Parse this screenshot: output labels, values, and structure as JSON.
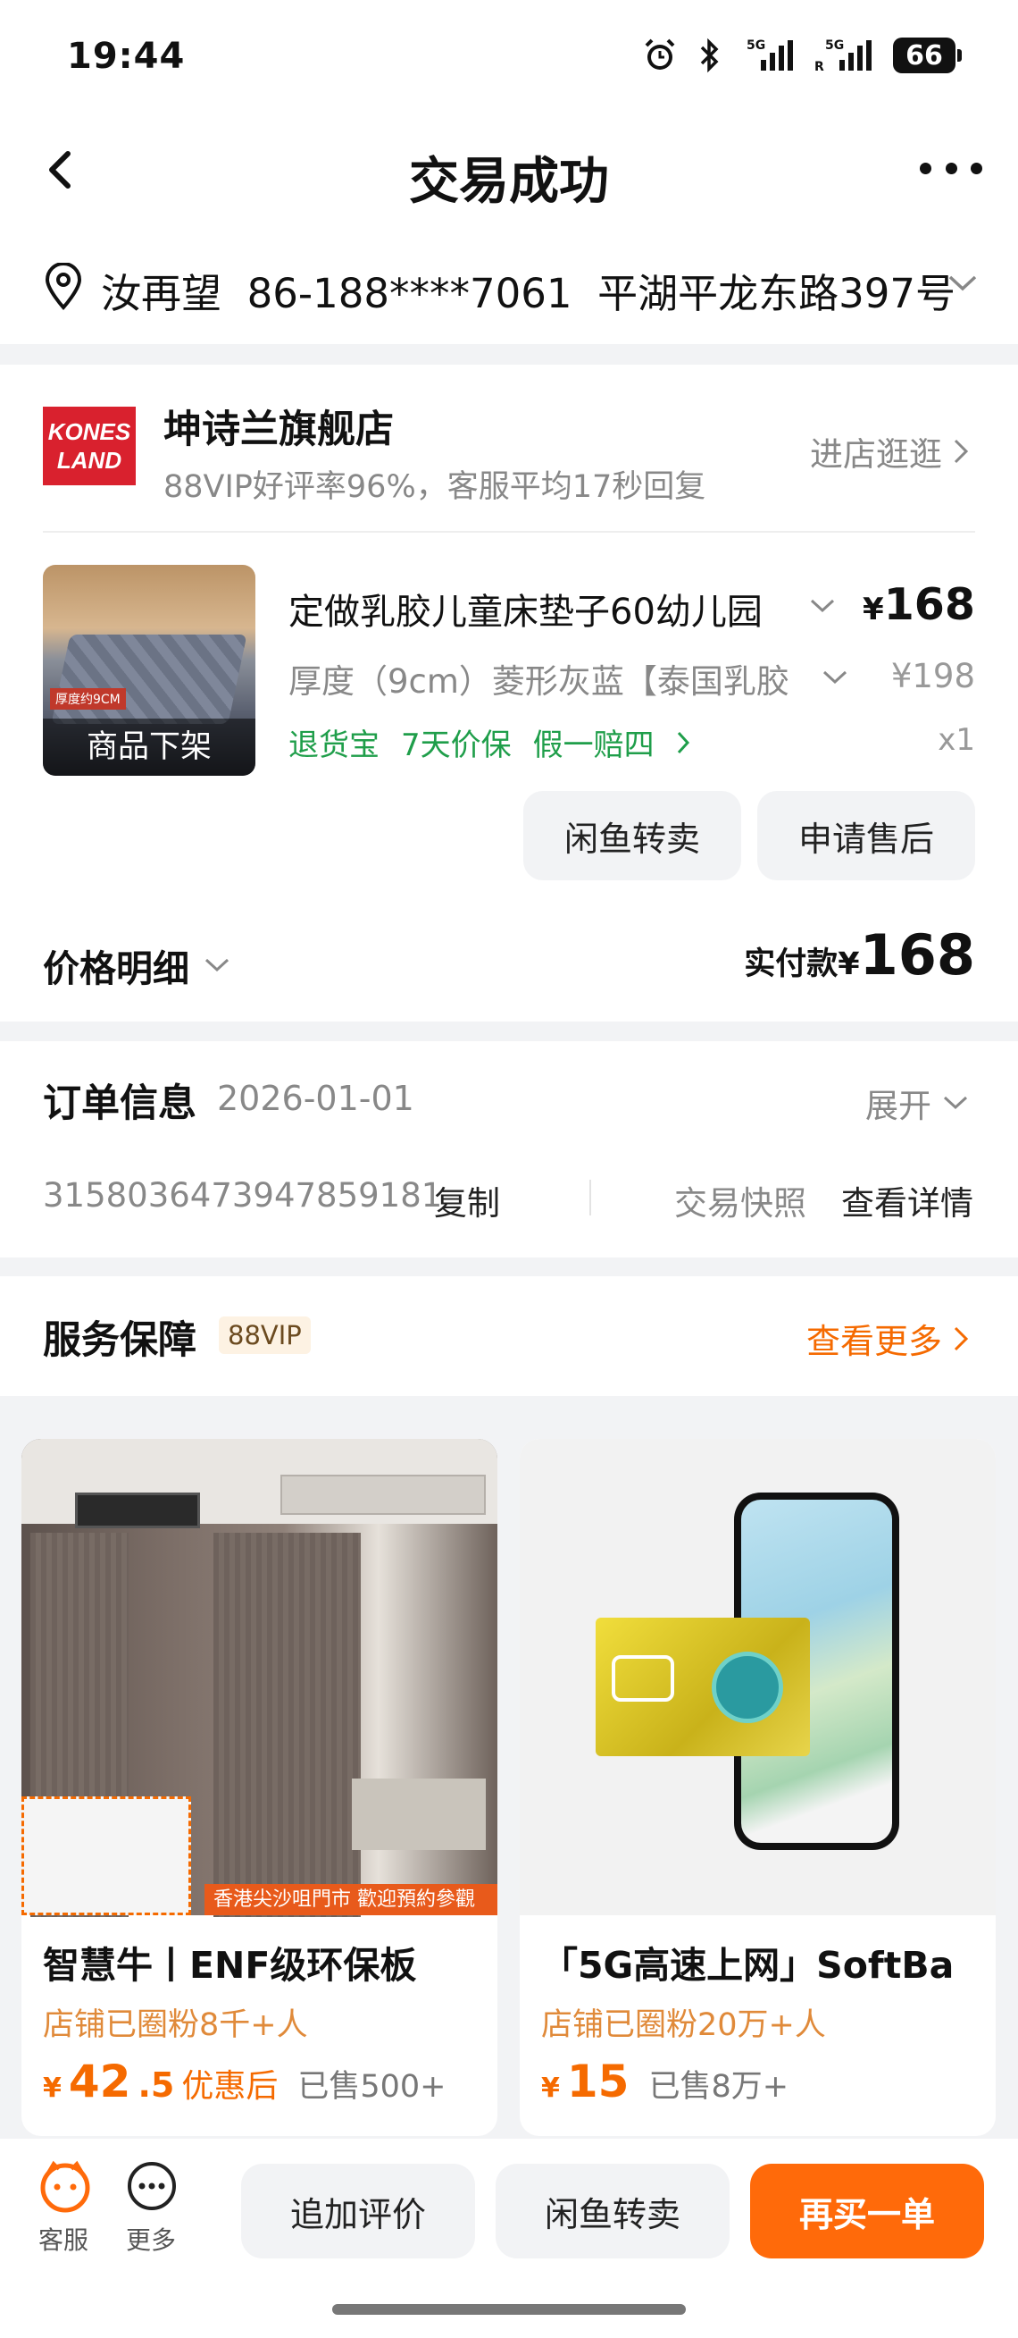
{
  "status": {
    "time": "19:44",
    "battery": "66"
  },
  "nav": {
    "title": "交易成功"
  },
  "address": {
    "name": "汝再望",
    "phone": "86-188****7061",
    "detail": "平湖平龙东路397号"
  },
  "store": {
    "logo_line1": "KONES",
    "logo_line2": "LAND",
    "name": "坤诗兰旗舰店",
    "sub": "88VIP好评率96%，客服平均17秒回复",
    "enter": "进店逛逛"
  },
  "product": {
    "img_overlay": "商品下架",
    "img_tag": "厚度约9CM",
    "title": "定做乳胶儿童床垫子60幼儿园",
    "spec": "厚度（9cm）菱形灰蓝【泰国乳胶",
    "price": "168",
    "currency": "¥",
    "orig_price": "¥198",
    "qty": "x1",
    "services": [
      "退货宝",
      "7天价保",
      "假一赔四"
    ]
  },
  "actions": {
    "resell": "闲鱼转卖",
    "after_sale": "申请售后"
  },
  "price_detail": {
    "label": "价格明细",
    "paid_label": "实付款",
    "currency": "¥",
    "amount": "168"
  },
  "order_info": {
    "title": "订单信息",
    "date": "2026-01-01",
    "expand": "展开",
    "order_no": "3158036473947859181",
    "copy": "复制",
    "snapshot": "交易快照",
    "details": "查看详情"
  },
  "service": {
    "title": "服务保障",
    "badge": "88VIP",
    "more": "查看更多"
  },
  "recommendations": [
    {
      "title": "智慧牛丨ENF级环保板",
      "fans": "店铺已圈粉8千+人",
      "currency": "¥",
      "price_int": "42",
      "price_dec": ".5",
      "price_tag": "优惠后",
      "sold": "已售500+",
      "banner": "香港尖沙咀門市 歡迎預約參觀"
    },
    {
      "title": "「5G高速上网」SoftBa",
      "fans": "店铺已圈粉20万+人",
      "currency": "¥",
      "price_int": "15",
      "price_dec": "",
      "price_tag": "",
      "sold": "已售8万+"
    }
  ],
  "bottom": {
    "service_label": "客服",
    "more_label": "更多",
    "review": "追加评价",
    "resell": "闲鱼转卖",
    "rebuy": "再买一单"
  },
  "colors": {
    "accent": "#ff6a0a",
    "green": "#1f9e4a",
    "store_red": "#d9212e"
  }
}
